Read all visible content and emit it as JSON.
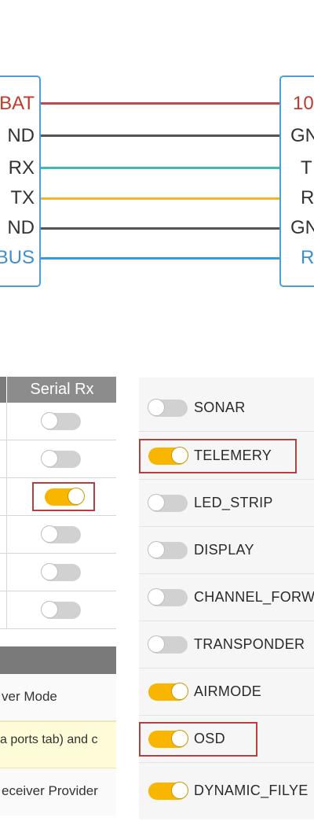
{
  "wiring": {
    "left_pins": [
      {
        "label": "BAT",
        "color": "#c0392b"
      },
      {
        "label": "ND",
        "color": "#333333"
      },
      {
        "label": "RX",
        "color": "#333333"
      },
      {
        "label": "TX",
        "color": "#333333"
      },
      {
        "label": "ND",
        "color": "#333333"
      },
      {
        "label": "BUS",
        "color": "#3a8fd0"
      }
    ],
    "right_pins": [
      {
        "label": "10",
        "color": "#c0392b"
      },
      {
        "label": "GN",
        "color": "#333333"
      },
      {
        "label": "T",
        "color": "#333333"
      },
      {
        "label": "R",
        "color": "#333333"
      },
      {
        "label": "GN",
        "color": "#333333"
      },
      {
        "label": "R",
        "color": "#3a8fd0"
      }
    ],
    "wire_colors": [
      "#c0484d",
      "#555555",
      "#3fbab8",
      "#f2b52a",
      "#555555",
      "#3b9ad8"
    ]
  },
  "ports_table": {
    "header": "Serial Rx",
    "serial_rx_toggles": [
      false,
      false,
      true,
      false,
      false,
      false
    ]
  },
  "receiver": {
    "rows": [
      "ver Mode",
      "a ports tab) and c",
      "eceiver Provider"
    ]
  },
  "features": [
    {
      "label": "SONAR",
      "enabled": false
    },
    {
      "label": "TELEMERY",
      "enabled": true
    },
    {
      "label": "LED_STRIP",
      "enabled": false
    },
    {
      "label": "DISPLAY",
      "enabled": false
    },
    {
      "label": "CHANNEL_FORW",
      "enabled": false
    },
    {
      "label": "TRANSPONDER",
      "enabled": false
    },
    {
      "label": "AIRMODE",
      "enabled": true
    },
    {
      "label": "OSD",
      "enabled": true
    },
    {
      "label": "DYNAMIC_FILYE",
      "enabled": true
    }
  ],
  "colors": {
    "highlight": "#b34040",
    "toggle_on": "#f9b600",
    "toggle_off": "#d1d1d1",
    "connector": "#4a9fd8"
  }
}
